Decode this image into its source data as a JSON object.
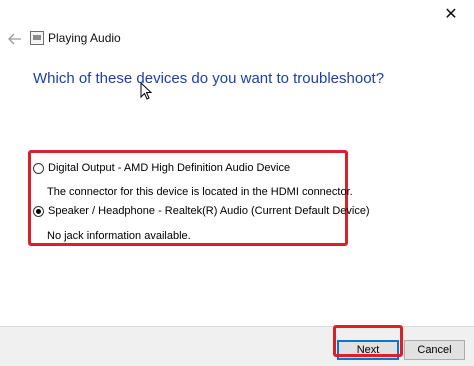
{
  "window": {
    "close_glyph": "✕",
    "back_icon": "arrow-left-icon",
    "app_icon": "playing-audio-icon",
    "title": "Playing Audio"
  },
  "main": {
    "question": "Which of these devices do you want to troubleshoot?",
    "options": [
      {
        "label": "Digital Output - AMD High Definition Audio Device",
        "description": "The connector for this device is located in the HDMI connector.",
        "selected": false
      },
      {
        "label": "Speaker / Headphone - Realtek(R) Audio (Current Default Device)",
        "description": "No jack information available.",
        "selected": true
      }
    ]
  },
  "footer": {
    "next_label": "Next",
    "cancel_label": "Cancel"
  },
  "colors": {
    "question": "#1f3fa8",
    "highlight": "#d9202b",
    "footer_bg": "#f0f0f0"
  }
}
